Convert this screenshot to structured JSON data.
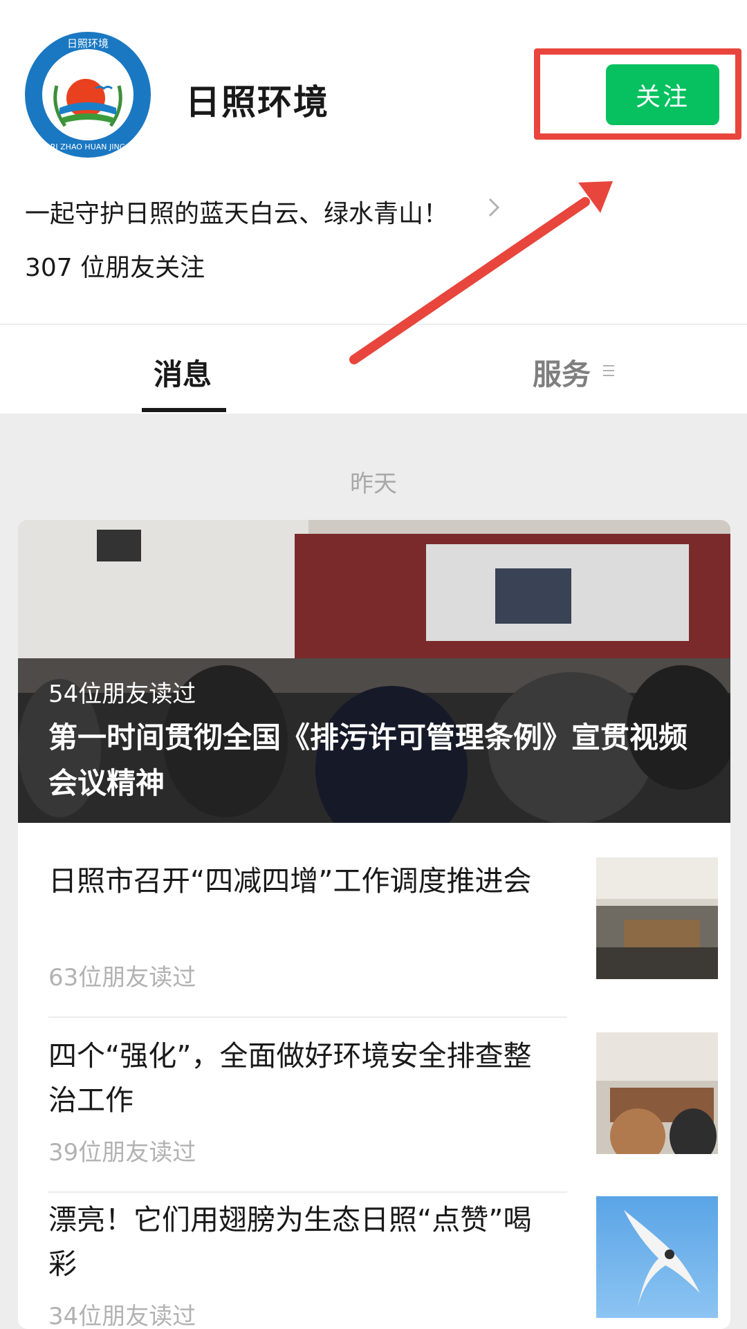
{
  "account": {
    "name": "日照环境",
    "logo_text_top": "日照环境",
    "logo_text_bottom": "RI ZHAO HUAN JING",
    "description": "一起守护日照的蓝天白云、绿水青山！",
    "followers": "307 位朋友关注",
    "follow_label": "关注"
  },
  "tabs": {
    "messages": "消息",
    "services": "服务"
  },
  "feed": {
    "date_label": "昨天",
    "hero": {
      "reads": "54位朋友读过",
      "title": "第一时间贯彻全国《排污许可管理条例》宣贯视频会议精神"
    },
    "items": [
      {
        "title": "日照市召开“四减四增”工作调度推进会",
        "reads": "63位朋友读过"
      },
      {
        "title": "四个“强化”，全面做好环境安全排查整治工作",
        "reads": "39位朋友读过"
      },
      {
        "title": "漂亮！它们用翅膀为生态日照“点赞”喝彩",
        "reads": "34位朋友读过"
      }
    ]
  },
  "colors": {
    "follow_green": "#07c160",
    "annotation_red": "#e8453c"
  }
}
